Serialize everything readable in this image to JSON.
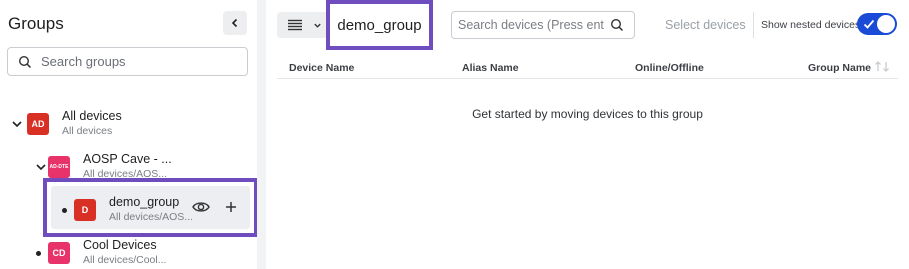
{
  "sidebar": {
    "title": "Groups",
    "search_placeholder": "Search groups",
    "tree": [
      {
        "name": "All devices",
        "path": "All devices",
        "avatar": "AD",
        "avatar_color": "#d93025"
      },
      {
        "name": "AOSP Cave - ...",
        "path": "All devices/AOS...",
        "avatar": "AD-DTE",
        "avatar_color": "#e8336a"
      },
      {
        "name": "demo_group",
        "path": "All devices/AOS...",
        "avatar": "D",
        "avatar_color": "#d93025"
      },
      {
        "name": "Cool Devices",
        "path": "All devices/Cool...",
        "avatar": "CD",
        "avatar_color": "#e8336a"
      }
    ]
  },
  "main": {
    "group_title": "demo_group",
    "device_search_placeholder": "Search devices (Press enter to search)",
    "select_devices_label": "Select devices",
    "show_nested_label": "Show nested devices",
    "show_nested_enabled": true,
    "columns": [
      "Device Name",
      "Alias Name",
      "Online/Offline",
      "Group Name"
    ],
    "empty_message": "Get started by moving devices to this group"
  },
  "colors": {
    "highlight": "#6f4dbf",
    "toggle_on": "#1a4bd6"
  }
}
